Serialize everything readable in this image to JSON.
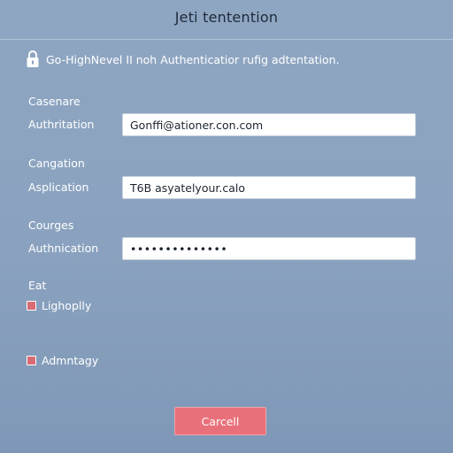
{
  "header": {
    "title": "Jeti tentention"
  },
  "notice": {
    "icon": "lock-icon",
    "text": "Go-HighNevel II noh Authenticatior rufig adtentation."
  },
  "sections": {
    "section1": "Casenare",
    "section2": "Cangation",
    "section3": "Courges",
    "section4": "Eat"
  },
  "fields": {
    "authorization": {
      "label": "Authritation",
      "value": "Gonffi@ationer.con.com"
    },
    "application": {
      "label": "Asplication",
      "value": "T6B asyatelyour.calo"
    },
    "authentication": {
      "label": "Authnication",
      "value": "••••••••••••••"
    }
  },
  "checkboxes": {
    "first": {
      "label": "Lighoplly"
    },
    "second": {
      "label": "Admntagy"
    }
  },
  "actions": {
    "cancel_label": "Carcell"
  },
  "colors": {
    "background": "#8aa2bf",
    "accent": "#e8707a",
    "title_text": "#1f2a3a"
  }
}
